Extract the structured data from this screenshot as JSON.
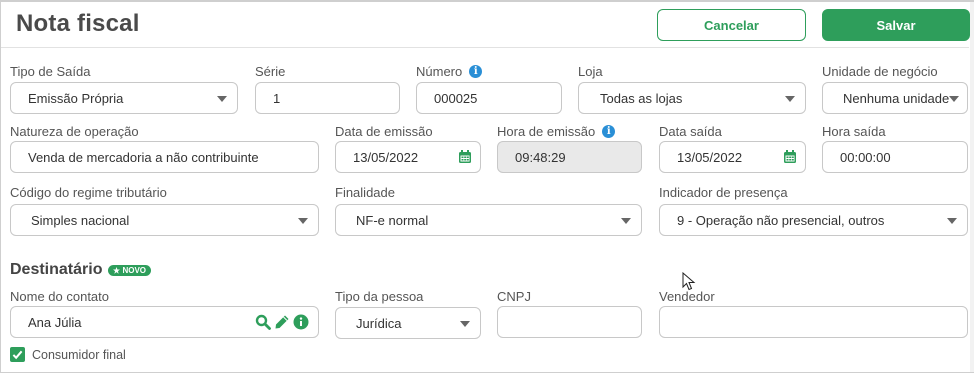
{
  "header": {
    "title": "Nota fiscal",
    "cancel_label": "Cancelar",
    "save_label": "Salvar"
  },
  "row1": {
    "tipo_saida": {
      "label": "Tipo de Saída",
      "value": "Emissão Própria"
    },
    "serie": {
      "label": "Série",
      "value": "1"
    },
    "numero": {
      "label": "Número",
      "value": "000025"
    },
    "loja": {
      "label": "Loja",
      "value": "Todas as lojas"
    },
    "unidade": {
      "label": "Unidade de negócio",
      "value": "Nenhuma unidade"
    }
  },
  "row2": {
    "natureza": {
      "label": "Natureza de operação",
      "value": "Venda de mercadoria a não contribuinte"
    },
    "data_emissao": {
      "label": "Data de emissão",
      "value": "13/05/2022"
    },
    "hora_emissao": {
      "label": "Hora de emissão",
      "value": "09:48:29"
    },
    "data_saida": {
      "label": "Data saída",
      "value": "13/05/2022"
    },
    "hora_saida": {
      "label": "Hora saída",
      "value": "00:00:00"
    }
  },
  "row3": {
    "regime": {
      "label": "Código do regime tributário",
      "value": "Simples nacional"
    },
    "finalidade": {
      "label": "Finalidade",
      "value": "NF-e normal"
    },
    "presenca": {
      "label": "Indicador de presença",
      "value": "9 - Operação não presencial, outros"
    }
  },
  "destinatario": {
    "title": "Destinatário",
    "badge": "NOVO",
    "nome": {
      "label": "Nome do contato",
      "value": "Ana Júlia"
    },
    "tipo_pessoa": {
      "label": "Tipo da pessoa",
      "value": "Jurídica"
    },
    "cnpj": {
      "label": "CNPJ",
      "value": ""
    },
    "vendedor": {
      "label": "Vendedor",
      "value": ""
    },
    "consumidor_final": {
      "label": "Consumidor final",
      "checked": true
    }
  },
  "colors": {
    "accent": "#2e9e5b",
    "info": "#2a8fd6"
  },
  "icons": [
    "info-icon",
    "calendar-icon",
    "chevron-down-icon",
    "search-icon",
    "pencil-icon",
    "star-icon",
    "check-icon",
    "mouse-cursor-icon"
  ]
}
